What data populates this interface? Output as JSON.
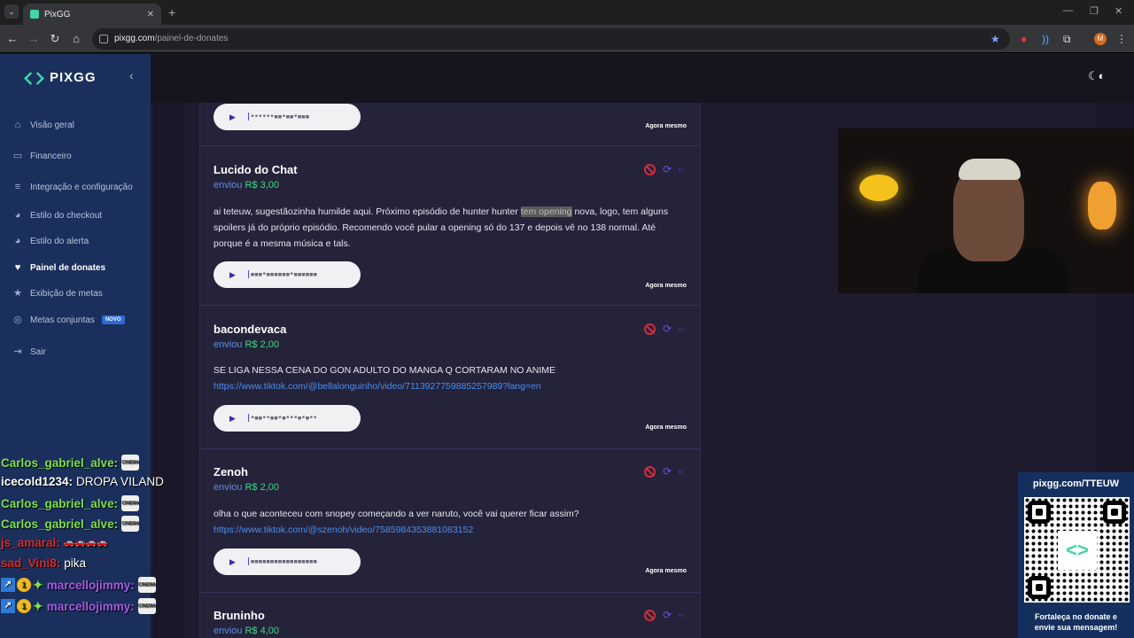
{
  "browser": {
    "tab_title": "PixGG",
    "url_host": "pixgg.com",
    "url_path": "/painel-de-donates"
  },
  "sidebar": {
    "logo": "PIXGG",
    "items": [
      {
        "label": "Visão geral",
        "icon": "home-icon"
      },
      {
        "label": "Financeiro",
        "icon": "wallet-icon"
      },
      {
        "label": "Integração e configuração",
        "icon": "settings-icon"
      },
      {
        "label": "Estilo do checkout",
        "icon": "palette-icon"
      },
      {
        "label": "Estilo do alerta",
        "icon": "palette-icon"
      },
      {
        "label": "Painel de donates",
        "icon": "donate-icon"
      },
      {
        "label": "Exibição de metas",
        "icon": "star-icon"
      },
      {
        "label": "Metas conjuntas",
        "icon": "target-icon",
        "badge": "NOVO"
      },
      {
        "label": "Sair",
        "icon": "logout-icon"
      }
    ]
  },
  "donations": [
    {
      "name": "",
      "time": "Agora mesmo"
    },
    {
      "name": "Lucido do Chat",
      "sent": "enviou",
      "amount": "R$ 3,00",
      "msg_before": "ai teteuw, sugestãozinha humilde aqui. Próximo episódio de hunter hunter ",
      "msg_highlight": "tem opening",
      "msg_after": " nova, logo, tem alguns spoilers já do próprio episódio. Recomendo você pular a opening só do 137 e depois vê no 138 normal. Até porque é a mesma música e tals.",
      "time": "Agora mesmo"
    },
    {
      "name": "bacondevaca",
      "sent": "enviou",
      "amount": "R$ 2,00",
      "message": "SE LIGA NESSA CENA DO GON ADULTO DO MANGA Q CORTARAM NO ANIME",
      "link": "https://www.tiktok.com/@bellalonguinho/video/7113927759885257989?lang=en",
      "time": "Agora mesmo"
    },
    {
      "name": "Zenoh",
      "sent": "enviou",
      "amount": "R$ 2,00",
      "message": "olha o que aconteceu com snopey começando a ver naruto, você vai querer ficar assim?",
      "link": "https://www.tiktok.com/@szenoh/video/7585984353881083152",
      "time": "Agora mesmo"
    },
    {
      "name": "Bruninho",
      "sent": "enviou",
      "amount": "R$ 4,00"
    }
  ],
  "chat": [
    {
      "user": "Carlos_gabriel_alve:",
      "color": "#7fe04a",
      "msg": "",
      "emote": "CINEMA"
    },
    {
      "user": "icecold1234:",
      "color": "#ffffff",
      "msg": "DROPA VILAND"
    },
    {
      "user": "Carlos_gabriel_alve:",
      "color": "#7fe04a",
      "msg": "",
      "emote": "CINEMA"
    },
    {
      "user": "Carlos_gabriel_alve:",
      "color": "#7fe04a",
      "msg": "",
      "emote": "CINEMA"
    },
    {
      "user": "js_amaral:",
      "color": "#d42b2b",
      "msg": ""
    },
    {
      "user": "sad_Vini8:",
      "color": "#d42b2b",
      "msg": "pika"
    },
    {
      "user": "marcellojimmy:",
      "color": "#a35ae0",
      "msg": "",
      "emote": "CINEMA"
    },
    {
      "user": "marcellojimmy:",
      "color": "#a35ae0",
      "msg": "",
      "emote": "CINEMA"
    }
  ],
  "qr": {
    "title": "pixgg.com/TTEUW",
    "caption_line1": "Fortaleça no donate e",
    "caption_line2": "envie sua mensagem!"
  }
}
